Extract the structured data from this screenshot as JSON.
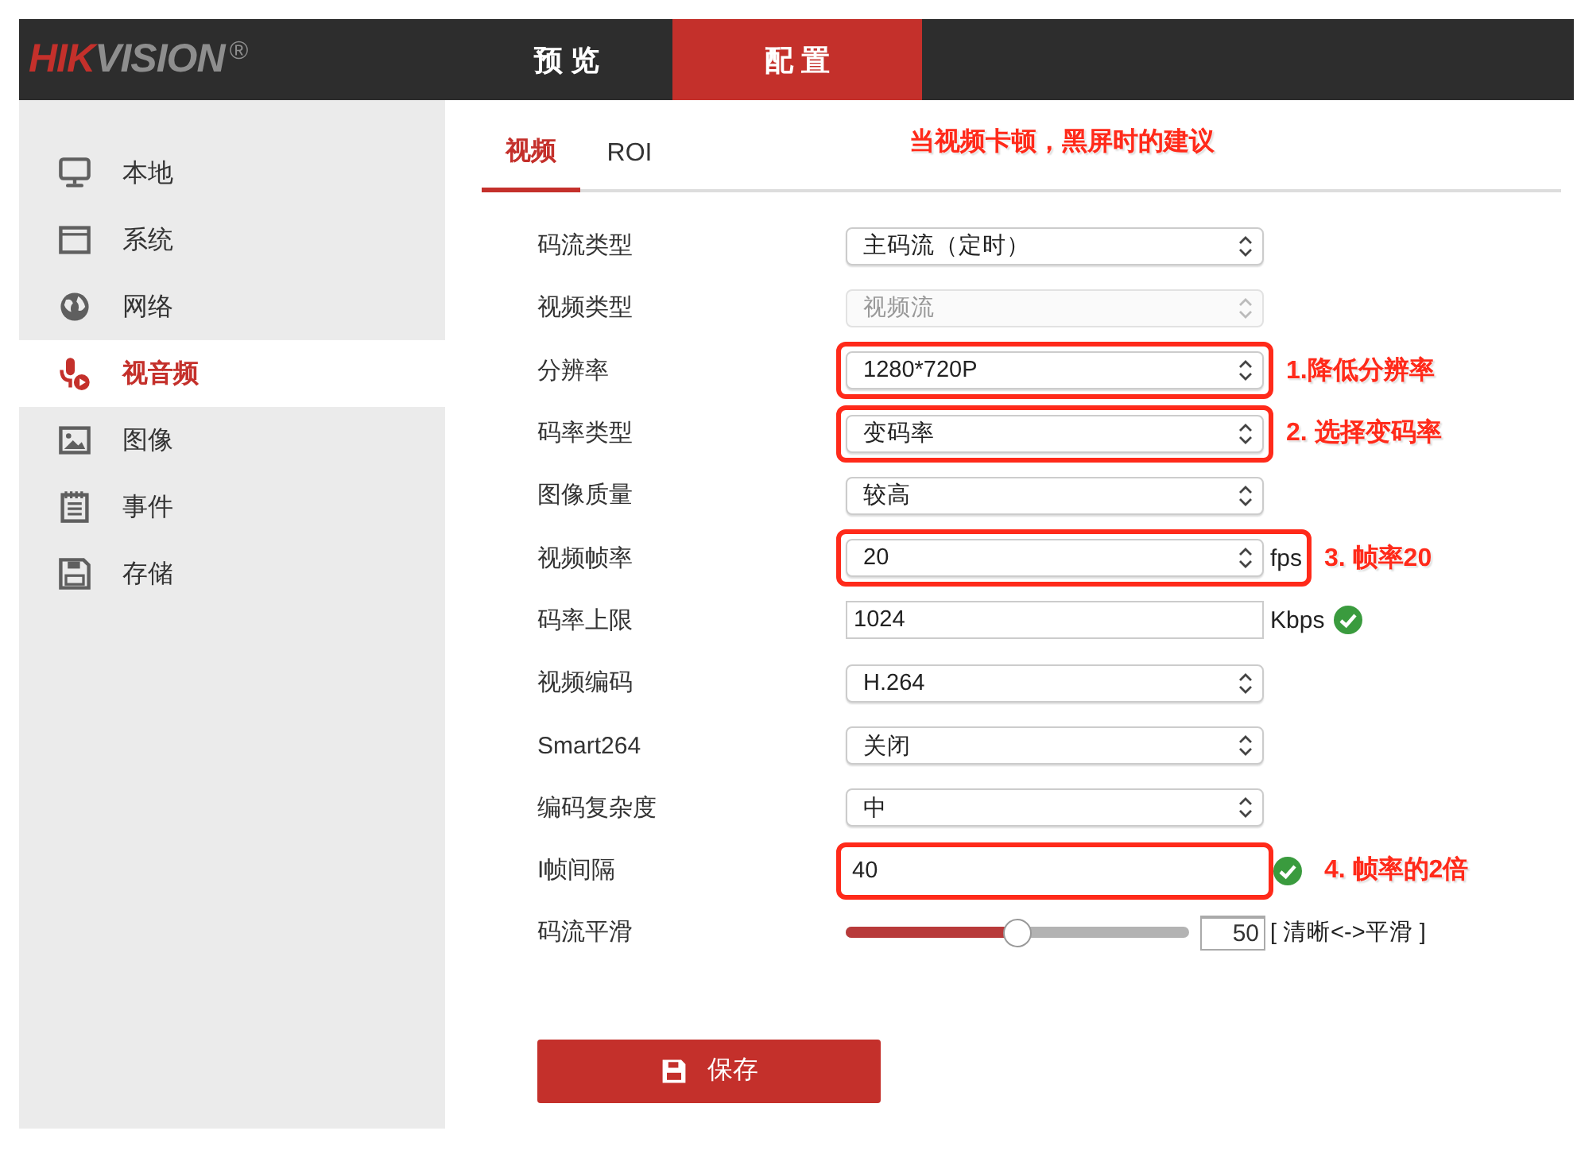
{
  "header": {
    "logo": {
      "accent": "HIK",
      "rest": "VISION",
      "mark": "®"
    },
    "nav": [
      {
        "label": "预 览",
        "selected": false
      },
      {
        "label": "配 置",
        "selected": true
      }
    ]
  },
  "sidebar": {
    "items": [
      {
        "label": "本地",
        "selected": false
      },
      {
        "label": "系统",
        "selected": false
      },
      {
        "label": "网络",
        "selected": false
      },
      {
        "label": "视音频",
        "selected": true
      },
      {
        "label": "图像",
        "selected": false
      },
      {
        "label": "事件",
        "selected": false
      },
      {
        "label": "存储",
        "selected": false
      }
    ]
  },
  "tabs": [
    {
      "label": "视频",
      "selected": true
    },
    {
      "label": "ROI",
      "selected": false
    }
  ],
  "annotation_title": "当视频卡顿，黑屏时的建议",
  "form": {
    "rows": [
      {
        "label": "码流类型",
        "kind": "select",
        "value": "主码流（定时）",
        "disabled": false,
        "highlighted": false,
        "valid": false
      },
      {
        "label": "视频类型",
        "kind": "select",
        "value": "视频流",
        "disabled": true,
        "highlighted": false,
        "valid": false
      },
      {
        "label": "分辨率",
        "kind": "select",
        "value": "1280*720P",
        "disabled": false,
        "highlighted": true,
        "valid": false,
        "note": "1.降低分辨率"
      },
      {
        "label": "码率类型",
        "kind": "select",
        "value": "变码率",
        "disabled": false,
        "highlighted": true,
        "valid": false,
        "note": "2. 选择变码率"
      },
      {
        "label": "图像质量",
        "kind": "select",
        "value": "较高",
        "disabled": false,
        "highlighted": false,
        "valid": false
      },
      {
        "label": "视频帧率",
        "kind": "select",
        "value": "20",
        "unit": "fps",
        "disabled": false,
        "highlighted": true,
        "valid": false,
        "note": "3. 帧率20"
      },
      {
        "label": "码率上限",
        "kind": "input",
        "value": "1024",
        "unit": "Kbps",
        "disabled": false,
        "highlighted": false,
        "valid": true
      },
      {
        "label": "视频编码",
        "kind": "select",
        "value": "H.264",
        "disabled": false,
        "highlighted": false,
        "valid": false
      },
      {
        "label": "Smart264",
        "kind": "select",
        "value": "关闭",
        "disabled": false,
        "highlighted": false,
        "valid": false
      },
      {
        "label": "编码复杂度",
        "kind": "select",
        "value": "中",
        "disabled": false,
        "highlighted": false,
        "valid": false
      },
      {
        "label": "I帧间隔",
        "kind": "input",
        "value": "40",
        "disabled": false,
        "highlighted": true,
        "valid": true,
        "note": "4. 帧率的2倍"
      },
      {
        "label": "码流平滑",
        "kind": "slider",
        "level": 0.5,
        "value": "50",
        "hint": "[ 清晰<->平滑 ]",
        "disabled": false,
        "highlighted": false,
        "valid": false
      }
    ]
  },
  "save_button": "保存"
}
